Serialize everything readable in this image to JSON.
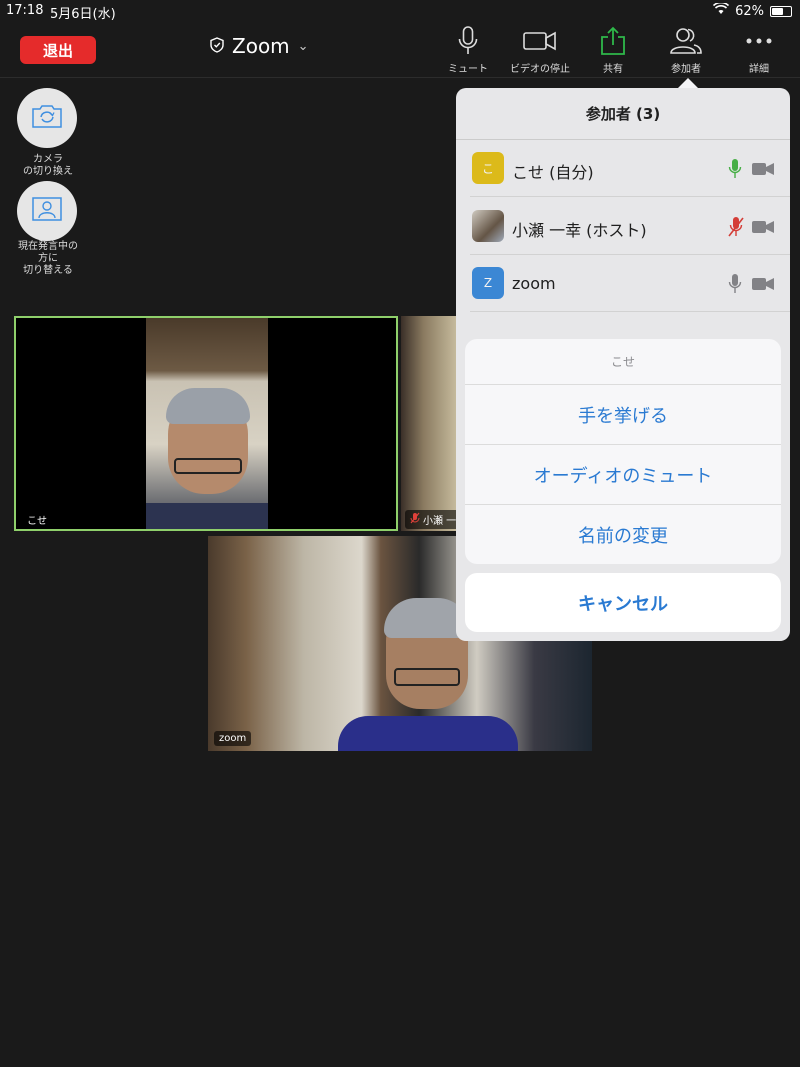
{
  "status_bar": {
    "time": "17:18",
    "date": "5月6日(水)",
    "battery": "62%",
    "battery_level": 0.62
  },
  "top_bar": {
    "leave_label": "退出",
    "meeting_title": "Zoom",
    "tools": {
      "mute": "ミュート",
      "stop_video": "ビデオの停止",
      "share": "共有",
      "participants": "参加者",
      "more": "詳細"
    }
  },
  "left_controls": {
    "switch_camera": "カメラ\nの切り換え",
    "switch_speaker": "現在発言中の\n方に\n切り替える"
  },
  "videos": {
    "self_label": "こせ",
    "host_label": "小瀬 一",
    "zoom_label": "zoom"
  },
  "participants_panel": {
    "title": "参加者 (3)",
    "rows": [
      {
        "initial": "こ",
        "name": "こせ (自分)",
        "avatar_color": "#e8c51c",
        "mic": "active"
      },
      {
        "initial": "",
        "name": "小瀬 一幸 (ホスト)",
        "avatar_color": "#8d8d8d",
        "mic": "muted"
      },
      {
        "initial": "Z",
        "name": "zoom",
        "avatar_color": "#3f8fe0",
        "mic": "idle"
      }
    ]
  },
  "action_sheet": {
    "title": "こせ",
    "items": [
      "手を挙げる",
      "オーディオのミュート",
      "名前の変更"
    ],
    "cancel": "キャンセル"
  },
  "colors": {
    "leave_red": "#e52b2b",
    "share_green": "#2fb84a",
    "action_blue": "#2a7ad2",
    "active_speaker_border": "#8fd06b",
    "mic_green": "#4bb84a",
    "mic_red": "#e0413a"
  }
}
